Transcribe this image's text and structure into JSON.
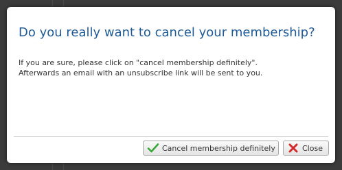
{
  "dialog": {
    "title": "Do you really want to cancel your membership?",
    "body_line_1": "If you are sure, please click on \"cancel membership definitely\".",
    "body_line_2": "Afterwards an email with an unsubscribe link will be sent to you."
  },
  "buttons": {
    "confirm_label": "Cancel membership definitely",
    "confirm_icon": "checkmark-icon",
    "close_label": "Close",
    "close_icon": "x-mark-icon"
  },
  "colors": {
    "title": "#1f5a94",
    "checkmark": "#3aa63a",
    "x_mark": "#d12a2a",
    "backdrop": "#3b3b3b"
  }
}
